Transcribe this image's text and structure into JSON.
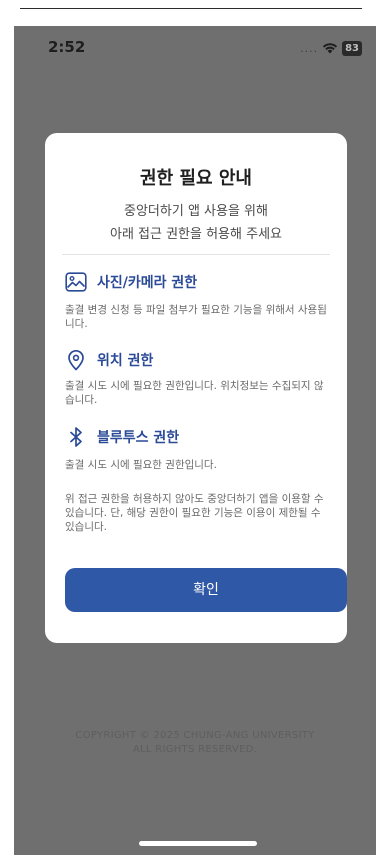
{
  "status_bar": {
    "time": "2:52",
    "signal_text": "....",
    "battery_level": "83"
  },
  "modal": {
    "title": "권한 필요 안내",
    "subtitle_line1": "중앙더하기 앱 사용을 위해",
    "subtitle_line2": "아래 접근 권한을 허용해 주세요",
    "permissions": [
      {
        "icon": "image-icon",
        "title": "사진/카메라 권한",
        "description": "출결 변경 신청 등 파일 첨부가 필요한 기능을 위해서 사용됩니다."
      },
      {
        "icon": "location-pin-icon",
        "title": "위치 권한",
        "description": "출결 시도 시에 필요한 권한입니다. 위치정보는 수집되지 않습니다."
      },
      {
        "icon": "bluetooth-icon",
        "title": "블루투스 권한",
        "description": "출결 시도 시에 필요한 권한입니다."
      }
    ],
    "notice": "위 접근 권한을 허용하지 않아도 중앙더하기 앱을 이용할 수 있습니다. 단, 해당 권한이 필요한 기능은 이용이 제한될 수 있습니다.",
    "confirm_label": "확인"
  },
  "footer": {
    "copyright_line1": "COPYRIGHT © 2025 CHUNG-ANG UNIVERSITY",
    "copyright_line2": "ALL RIGHTS RESERVED."
  },
  "colors": {
    "accent": "#2f58a6",
    "permission_title": "#2b4a97",
    "overlay": "#6f6f6f"
  }
}
